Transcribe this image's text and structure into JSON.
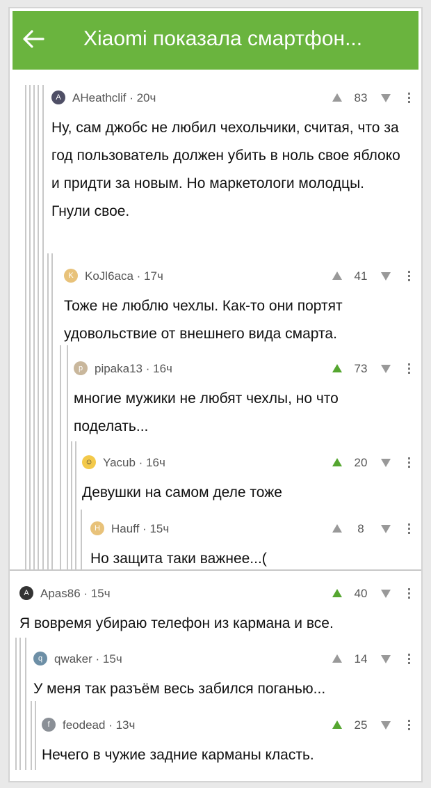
{
  "header": {
    "title": "Xiaomi показала смартфон..."
  },
  "comments": [
    {
      "author": "AHeathclif",
      "time": "20ч",
      "votes": "83",
      "upvoted": false,
      "text": "Ну, сам джобс не любил чехольчики, считая, что за год пользователь должен убить в ноль свое яблоко и придти за новым. Но маркетологи молодцы. Гнули свое."
    },
    {
      "author": "KoJl6aca",
      "time": "17ч",
      "votes": "41",
      "upvoted": false,
      "text": "Тоже не люблю чехлы. Как-то они портят удовольствие от внешнего вида смарта."
    },
    {
      "author": "pipaka13",
      "time": "16ч",
      "votes": "73",
      "upvoted": true,
      "text": "многие мужики не любят чехлы, но что поделать..."
    },
    {
      "author": "Yacub",
      "time": "16ч",
      "votes": "20",
      "upvoted": true,
      "text": "Девушки на самом деле тоже"
    },
    {
      "author": "Hauff",
      "time": "15ч",
      "votes": "8",
      "upvoted": false,
      "text": "Но защита таки важнее...("
    },
    {
      "author": "Apas86",
      "time": "15ч",
      "votes": "40",
      "upvoted": true,
      "text": "Я вовремя убираю телефон из кармана и все."
    },
    {
      "author": "qwaker",
      "time": "15ч",
      "votes": "14",
      "upvoted": false,
      "text": "У меня так разъём весь забился поганью..."
    },
    {
      "author": "feodead",
      "time": "13ч",
      "votes": "25",
      "upvoted": true,
      "text": "Нечего в чужие задние карманы класть."
    }
  ],
  "colors": {
    "header": "#6ab43e",
    "upvote_active": "#55a630",
    "vote_inactive": "#999999",
    "thread_line": "#c8c8c8"
  }
}
